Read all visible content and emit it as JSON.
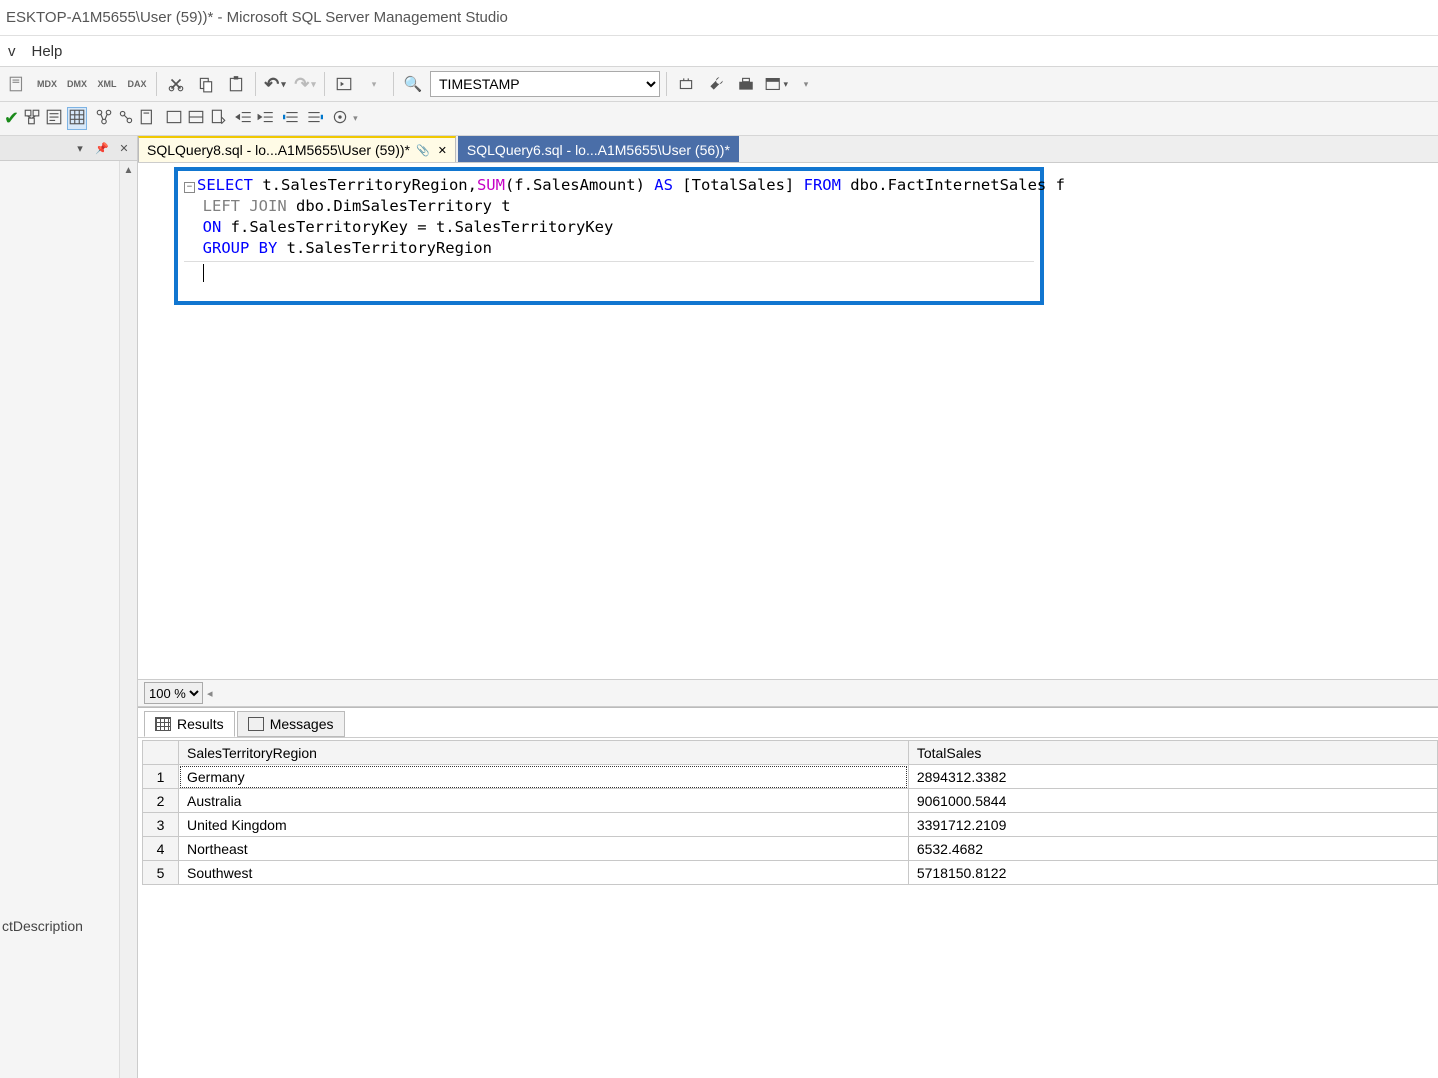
{
  "title": "ESKTOP-A1M5655\\User (59))* - Microsoft SQL Server Management Studio",
  "menu": {
    "item1": "v",
    "item2": "Help"
  },
  "toolbar": {
    "combo_value": "TIMESTAMP"
  },
  "left_panel": {
    "bottom_text": "ctDescription"
  },
  "tabs": [
    {
      "label": "SQLQuery8.sql - lo...A1M5655\\User (59))*",
      "active": true
    },
    {
      "label": "SQLQuery6.sql - lo...A1M5655\\User (56))*",
      "active": false
    }
  ],
  "sql": {
    "l1_select": "SELECT",
    "l1_mid": " t.SalesTerritoryRegion,",
    "l1_sum": "SUM",
    "l1_paren": "(f.SalesAmount) ",
    "l1_as": "AS",
    "l1_alias": " [TotalSales] ",
    "l1_from": "FROM",
    "l1_tbl": " dbo.FactInternetSales f",
    "l2_leftjoin": "LEFT JOIN",
    "l2_rest": " dbo.DimSalesTerritory t",
    "l3_on": "ON",
    "l3_rest": " f.SalesTerritoryKey = t.SalesTerritoryKey",
    "l4_group": "GROUP BY",
    "l4_rest": " t.SalesTerritoryRegion"
  },
  "zoom": "100 %",
  "results_tabs": {
    "results": "Results",
    "messages": "Messages"
  },
  "grid": {
    "headers": [
      "SalesTerritoryRegion",
      "TotalSales"
    ],
    "rows": [
      {
        "n": "1",
        "region": "Germany",
        "total": "2894312.3382"
      },
      {
        "n": "2",
        "region": "Australia",
        "total": "9061000.5844"
      },
      {
        "n": "3",
        "region": "United Kingdom",
        "total": "3391712.2109"
      },
      {
        "n": "4",
        "region": "Northeast",
        "total": "6532.4682"
      },
      {
        "n": "5",
        "region": "Southwest",
        "total": "5718150.8122"
      }
    ]
  }
}
